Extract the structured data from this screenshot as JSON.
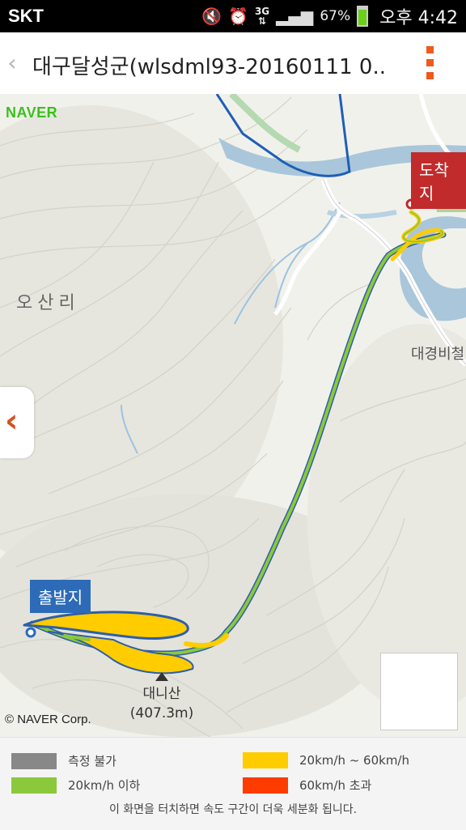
{
  "status_bar": {
    "carrier": "SKT",
    "network": "3G",
    "battery_pct": "67%",
    "time": "오후 4:42",
    "icons": [
      "mute-icon",
      "alarm-icon",
      "network-3g-icon",
      "signal-icon",
      "battery-icon"
    ]
  },
  "header": {
    "back_glyph": "‹",
    "title": "대구달성군(wlsdml93-20160111 0..."
  },
  "map": {
    "logo": "NAVER",
    "place_label": "오산리",
    "place_label_right": "대경비철",
    "start_label": "출발지",
    "end_label": "도착지",
    "mountain_name": "대니산",
    "mountain_elevation": "(407.3m)",
    "copyright": "© NAVER Corp.",
    "side_tab_glyph": "‹"
  },
  "legend": {
    "items": [
      {
        "label": "측정 불가",
        "color": "#888888"
      },
      {
        "label": "20km/h ~ 60km/h",
        "color": "#ffcc00"
      },
      {
        "label": "20km/h 이하",
        "color": "#8cc83c"
      },
      {
        "label": "60km/h 초과",
        "color": "#ff3c00"
      }
    ],
    "hint": "이 화면을 터치하면 속도 구간이 더욱 세분화 됩니다."
  },
  "colors": {
    "accent": "#ee5a1c",
    "start_marker": "#2d6bb9",
    "end_marker": "#c12b2b",
    "route_green": "#8cc83c",
    "route_yellow": "#ffcc00",
    "river": "#a9c6db"
  }
}
